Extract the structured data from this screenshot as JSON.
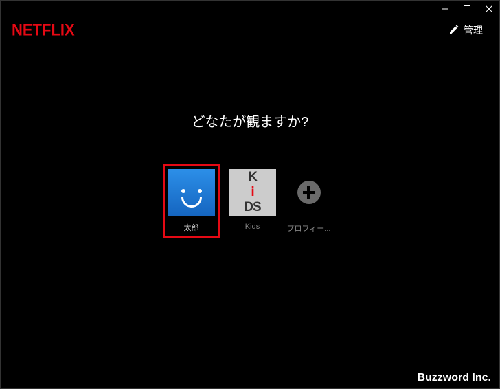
{
  "header": {
    "logo": "NETFLIX",
    "manage_label": "管理"
  },
  "prompt": "どなたが観ますか?",
  "profiles": [
    {
      "label": "太郎"
    },
    {
      "label": "Kids"
    }
  ],
  "add_profile_label": "プロフィー...",
  "watermark": "Buzzword Inc."
}
